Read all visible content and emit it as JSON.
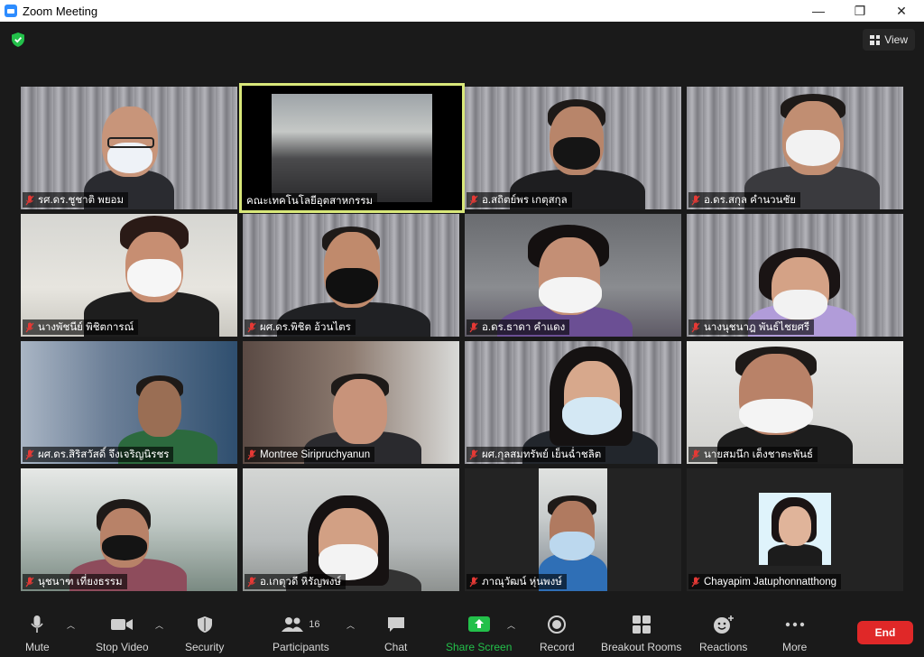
{
  "window": {
    "title": "Zoom Meeting",
    "controls": [
      "—",
      "❐",
      "✕"
    ]
  },
  "header": {
    "view_label": "View"
  },
  "participants": [
    {
      "name": "รศ.ดร.ชูชาติ  พยอม",
      "muted": true
    },
    {
      "name": "คณะเทคโนโลยีอุตสาหกรรม",
      "muted": false
    },
    {
      "name": "อ.สถิตย์พร  เกตุสกุล",
      "muted": true
    },
    {
      "name": "อ.ดร.สกุล  คำนวนชัย",
      "muted": true
    },
    {
      "name": "นางพัชนีย์  พิชิตการณ์",
      "muted": true
    },
    {
      "name": "ผศ.ดร.พิชิต  อ้วนไตร",
      "muted": true
    },
    {
      "name": "อ.ดร.ธาดา  คำแดง",
      "muted": true
    },
    {
      "name": "นางนุชนาฎ  พันธ์ไชยศรี",
      "muted": true
    },
    {
      "name": "ผศ.ดร.สิริสวัสดิ์  จึงเจริญนิรชร",
      "muted": true
    },
    {
      "name": "Montree Siripruchyanun",
      "muted": true
    },
    {
      "name": "ผศ.กุลสมทรัพย์  เย็นฉ่ำชลิต",
      "muted": true
    },
    {
      "name": "นายสมนึก  เต็งชาตะพันธ์",
      "muted": true
    },
    {
      "name": "นุชนาฑ  เที่ยงธรรม",
      "muted": true
    },
    {
      "name": "อ.เกตุวดี  หิรัญพงษ์",
      "muted": true
    },
    {
      "name": "ภาณุวัฒน์  หุ่นพงษ์",
      "muted": true
    },
    {
      "name": "Chayapim Jatuphonnatthong",
      "muted": true
    }
  ],
  "toolbar": {
    "mute": "Mute",
    "stop_video": "Stop Video",
    "security": "Security",
    "participants": "Participants",
    "participants_count": "16",
    "chat": "Chat",
    "share_screen": "Share Screen",
    "record": "Record",
    "breakout_rooms": "Breakout Rooms",
    "reactions": "Reactions",
    "more": "More",
    "end": "End"
  },
  "colors": {
    "share_green": "#23c04a",
    "end_red": "#e02828",
    "active_speaker": "#d9e87a",
    "muted_mic": "#e53935"
  }
}
